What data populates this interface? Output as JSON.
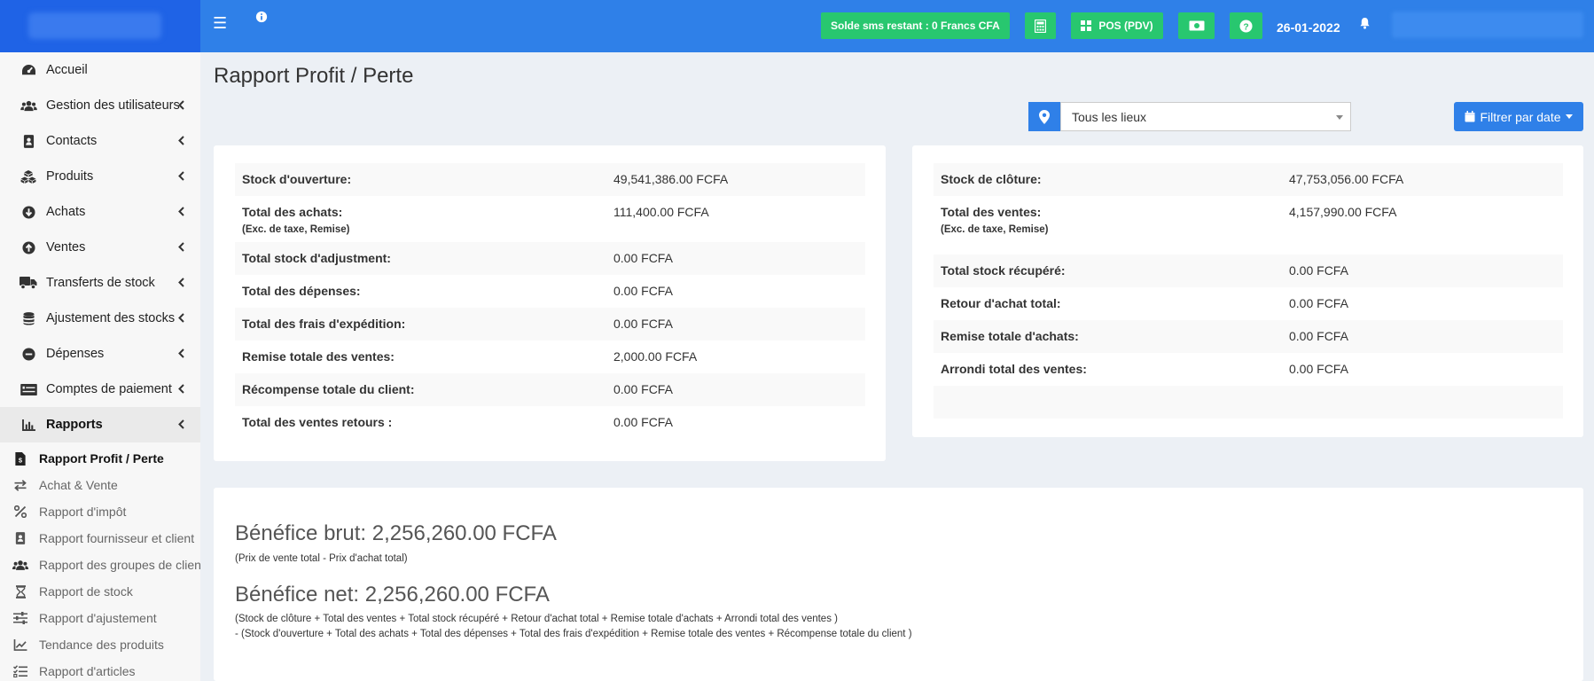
{
  "sidebar": {
    "menu": [
      {
        "label": "Accueil",
        "icon": "dashboard-icon",
        "chevron": false
      },
      {
        "label": "Gestion des utilisateurs",
        "icon": "users-icon",
        "chevron": true
      },
      {
        "label": "Contacts",
        "icon": "address-book-icon",
        "chevron": true
      },
      {
        "label": "Produits",
        "icon": "cubes-icon",
        "chevron": true
      },
      {
        "label": "Achats",
        "icon": "arrow-circle-down-icon",
        "chevron": true
      },
      {
        "label": "Ventes",
        "icon": "arrow-circle-up-icon",
        "chevron": true
      },
      {
        "label": "Transferts de stock",
        "icon": "truck-icon",
        "chevron": true
      },
      {
        "label": "Ajustement des stocks",
        "icon": "database-icon",
        "chevron": true
      },
      {
        "label": "Dépenses",
        "icon": "minus-circle-icon",
        "chevron": true
      },
      {
        "label": "Comptes de paiement",
        "icon": "money-check-icon",
        "chevron": true
      },
      {
        "label": "Rapports",
        "icon": "bar-chart-icon",
        "chevron": true
      }
    ],
    "submenu": [
      {
        "label": "Rapport Profit / Perte",
        "icon": "file-invoice-icon"
      },
      {
        "label": "Achat & Vente",
        "icon": "exchange-icon"
      },
      {
        "label": "Rapport d'impôt",
        "icon": "percent-icon"
      },
      {
        "label": "Rapport fournisseur et client",
        "icon": "address-card-icon"
      },
      {
        "label": "Rapport des groupes de client",
        "icon": "users-icon"
      },
      {
        "label": "Rapport de stock",
        "icon": "hourglass-icon"
      },
      {
        "label": "Rapport d'ajustement",
        "icon": "sliders-icon"
      },
      {
        "label": "Tendance des produits",
        "icon": "line-chart-icon"
      },
      {
        "label": "Rapport d'articles",
        "icon": "tasks-icon"
      }
    ]
  },
  "topbar": {
    "sms_label": "Solde sms restant : 0 Francs CFA",
    "pos_label": "POS (PDV)",
    "date": "26-01-2022"
  },
  "page": {
    "title": "Rapport Profit / Perte",
    "location_selected": "Tous les lieux",
    "filter_label": "Filtrer par date"
  },
  "left_table": [
    {
      "label": "Stock d'ouverture:",
      "note": "",
      "value": "49,541,386.00 FCFA"
    },
    {
      "label": "Total des achats:",
      "note": "(Exc. de taxe, Remise)",
      "value": "111,400.00 FCFA"
    },
    {
      "label": "Total stock d'adjustment:",
      "note": "",
      "value": "0.00 FCFA"
    },
    {
      "label": "Total des dépenses:",
      "note": "",
      "value": "0.00 FCFA"
    },
    {
      "label": "Total des frais d'expédition:",
      "note": "",
      "value": "0.00 FCFA"
    },
    {
      "label": "Remise totale des ventes:",
      "note": "",
      "value": "2,000.00 FCFA"
    },
    {
      "label": "Récompense totale du client:",
      "note": "",
      "value": "0.00 FCFA"
    },
    {
      "label": "Total des ventes retours :",
      "note": "",
      "value": "0.00 FCFA"
    }
  ],
  "right_table": [
    {
      "label": "Stock de clôture:",
      "note": "",
      "value": "47,753,056.00 FCFA"
    },
    {
      "label": "Total des ventes:",
      "note": "(Exc. de taxe, Remise)",
      "value": "4,157,990.00 FCFA"
    },
    {
      "label": "Total stock récupéré:",
      "note": "",
      "value": "0.00 FCFA"
    },
    {
      "label": "Retour d'achat total:",
      "note": "",
      "value": "0.00 FCFA"
    },
    {
      "label": "Remise totale d'achats:",
      "note": "",
      "value": "0.00 FCFA"
    },
    {
      "label": "Arrondi total des ventes:",
      "note": "",
      "value": "0.00 FCFA"
    },
    {
      "label": "",
      "note": "",
      "value": ""
    }
  ],
  "profit": {
    "gross_title": "Bénéfice brut: 2,256,260.00 FCFA",
    "gross_note": "(Prix de vente total - Prix d'achat total)",
    "net_title": "Bénéfice net: 2,256,260.00 FCFA",
    "net_note_1": "(Stock de clôture + Total des ventes + Total stock récupéré + Retour d'achat total + Remise totale d'achats + Arrondi total des ventes )",
    "net_note_2": "- (Stock d'ouverture + Total des achats + Total des dépenses + Total des frais d'expédition + Remise totale des ventes + Récompense totale du client )"
  }
}
